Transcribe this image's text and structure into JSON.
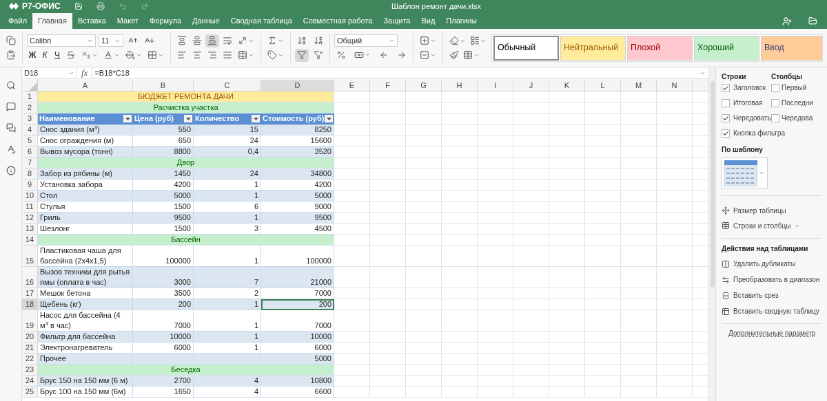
{
  "app": {
    "logo": "Р7-ОФИС",
    "title": "Шаблон ремонт дачи.xlsx"
  },
  "menu_tabs": [
    {
      "label": "Файл",
      "selected": false
    },
    {
      "label": "Главная",
      "selected": true
    },
    {
      "label": "Вставка",
      "selected": false
    },
    {
      "label": "Макет",
      "selected": false
    },
    {
      "label": "Формула",
      "selected": false
    },
    {
      "label": "Данные",
      "selected": false
    },
    {
      "label": "Сводная таблица",
      "selected": false
    },
    {
      "label": "Совместная работа",
      "selected": false
    },
    {
      "label": "Защита",
      "selected": false
    },
    {
      "label": "Вид",
      "selected": false
    },
    {
      "label": "Плагины",
      "selected": false
    }
  ],
  "toolbar": {
    "font": "Calibri",
    "font_size": "11",
    "format_buttons": [
      "Ж",
      "К",
      "Ч"
    ],
    "number_format": "Общий",
    "align_bottom_selected": true,
    "filter_selected": true,
    "styles": [
      {
        "label": {
          "text": "Обычный",
          "color": "#000000"
        },
        "color": "#ffffff",
        "selected": true
      },
      {
        "label": {
          "text": "Нейтральный",
          "color": "#9c5700"
        },
        "color": "#ffeb9c",
        "selected": false
      },
      {
        "label": {
          "text": "Плохой",
          "color": "#9c0006"
        },
        "color": "#ffc7ce",
        "selected": false
      },
      {
        "label": {
          "text": "Хороший",
          "color": "#006100"
        },
        "color": "#c6efce",
        "selected": false
      },
      {
        "label": {
          "text": "Ввод",
          "color": "#3f3f76"
        },
        "color": "#ffcc99",
        "selected": false
      }
    ]
  },
  "formula_bar": {
    "cell": "D18",
    "fx": "fx",
    "formula": "=B18*C18"
  },
  "sheet": {
    "columns": [
      {
        "label": "A",
        "selected": false
      },
      {
        "label": "B",
        "selected": false
      },
      {
        "label": "C",
        "selected": false
      },
      {
        "label": "D",
        "selected": true
      },
      {
        "label": "E",
        "selected": false
      },
      {
        "label": "F",
        "selected": false
      },
      {
        "label": "G",
        "selected": false
      },
      {
        "label": "H",
        "selected": false
      },
      {
        "label": "I",
        "selected": false
      },
      {
        "label": "J",
        "selected": false
      },
      {
        "label": "K",
        "selected": false
      },
      {
        "label": "L",
        "selected": false
      },
      {
        "label": "M",
        "selected": false
      },
      {
        "label": "N",
        "selected": false
      }
    ],
    "rows": [
      {
        "number": "1",
        "kind": "title",
        "text": "БЮДЖЕТ РЕМОНТА ДАЧИ",
        "selected": false
      },
      {
        "number": "2",
        "kind": "section",
        "text": "Расчистка участка",
        "selected": false
      },
      {
        "number": "3",
        "kind": "header",
        "cells": [
          "Наименование",
          "Цена (руб)",
          "Количество",
          "Стоимость (руб)"
        ],
        "selected": false
      },
      {
        "number": "4",
        "kind": "data",
        "banded": true,
        "selected": false,
        "cells": {
          "A": "Снос здания (м$^{3}$)",
          "B": "550",
          "C": "15",
          "D": "8250"
        }
      },
      {
        "number": "5",
        "kind": "data",
        "banded": false,
        "selected": false,
        "cells": {
          "A": "Снос ограждения (м)",
          "B": "650",
          "C": "24",
          "D": "15600"
        }
      },
      {
        "number": "6",
        "kind": "data",
        "banded": true,
        "selected": false,
        "cells": {
          "A": "Вывоз мусора (тонн)",
          "B": "8800",
          "C": "0,4",
          "D": "3520"
        }
      },
      {
        "number": "7",
        "kind": "section",
        "text": "Двор",
        "selected": false
      },
      {
        "number": "8",
        "kind": "data",
        "banded": true,
        "selected": false,
        "cells": {
          "A": "Забор из рябины (м)",
          "B": "1450",
          "C": "24",
          "D": "34800"
        }
      },
      {
        "number": "9",
        "kind": "data",
        "banded": false,
        "selected": false,
        "cells": {
          "A": "Установка забора",
          "B": "4200",
          "C": "1",
          "D": "4200"
        }
      },
      {
        "number": "10",
        "kind": "data",
        "banded": true,
        "selected": false,
        "cells": {
          "A": "Стол",
          "B": "5000",
          "C": "1",
          "D": "5000"
        }
      },
      {
        "number": "11",
        "kind": "data",
        "banded": false,
        "selected": false,
        "cells": {
          "A": "Стулья",
          "B": "1500",
          "C": "6",
          "D": "9000"
        }
      },
      {
        "number": "12",
        "kind": "data",
        "banded": true,
        "selected": false,
        "cells": {
          "A": "Гриль",
          "B": "9500",
          "C": "1",
          "D": "9500"
        }
      },
      {
        "number": "13",
        "kind": "data",
        "banded": false,
        "selected": false,
        "cells": {
          "A": "Шезлонг",
          "B": "1500",
          "C": "3",
          "D": "4500"
        }
      },
      {
        "number": "14",
        "kind": "section",
        "text": "Бассейн",
        "selected": false
      },
      {
        "number": "15",
        "kind": "data",
        "banded": false,
        "selected": false,
        "cells": {
          "A": "Пластиковая чаша для бассейна (2x4x1,5)",
          "B": "100000",
          "C": "1",
          "D": "100000"
        }
      },
      {
        "number": "16",
        "kind": "data",
        "banded": true,
        "selected": false,
        "cells": {
          "A": "Вызов техники для рытья ямы (оплата в час)",
          "B": "3000",
          "C": "7",
          "D": "21000"
        }
      },
      {
        "number": "17",
        "kind": "data",
        "banded": false,
        "selected": false,
        "cells": {
          "A": "Мешок бетона",
          "B": "3500",
          "C": "2",
          "D": "7000"
        }
      },
      {
        "number": "18",
        "kind": "data",
        "banded": true,
        "selected": true,
        "cells": {
          "A": "Щебень (кг)",
          "B": "200",
          "C": "1",
          "D": "200"
        }
      },
      {
        "number": "19",
        "kind": "data",
        "banded": false,
        "selected": false,
        "cells": {
          "A": "Насос для бассейна (4 м$^{3}$ в час)",
          "B": "7000",
          "C": "1",
          "D": "7000"
        }
      },
      {
        "number": "20",
        "kind": "data",
        "banded": true,
        "selected": false,
        "cells": {
          "A": "Фильтр для бассейна",
          "B": "10000",
          "C": "1",
          "D": "10000"
        }
      },
      {
        "number": "21",
        "kind": "data",
        "banded": false,
        "selected": false,
        "cells": {
          "A": "Электронагреватель",
          "B": "6000",
          "C": "1",
          "D": "6000"
        }
      },
      {
        "number": "22",
        "kind": "data",
        "banded": true,
        "selected": false,
        "cells": {
          "A": "Прочее",
          "D": "5000"
        }
      },
      {
        "number": "23",
        "kind": "section",
        "text": "Беседка",
        "selected": false
      },
      {
        "number": "24",
        "kind": "data",
        "banded": true,
        "selected": false,
        "cells": {
          "A": "Брус 150 на 150 мм (6 м)",
          "B": "2700",
          "C": "4",
          "D": "10800"
        }
      },
      {
        "number": "25",
        "kind": "data",
        "banded": false,
        "selected": false,
        "cells": {
          "A": "Брус 100 на 150 мм (6м)",
          "B": "1650",
          "C": "4",
          "D": "6600"
        }
      }
    ]
  },
  "table_panel": {
    "rows_heading": "Строки",
    "columns_heading": "Столбцы",
    "row_options": [
      {
        "label": "Заголовок",
        "checked": true
      },
      {
        "label": "Итоговая",
        "checked": false
      },
      {
        "label": "Чередовать",
        "checked": true
      },
      {
        "label": "Кнопка фильтра",
        "checked": true
      }
    ],
    "column_options": [
      {
        "label": "Первый",
        "checked": false
      },
      {
        "label": "Последни",
        "checked": false
      },
      {
        "label": "Чередова",
        "checked": false
      }
    ],
    "template_heading": "По шаблону",
    "links": [
      {
        "label": "Размер таблицы",
        "has_menu": false
      },
      {
        "label": "Строки и столбцы",
        "has_menu": true
      }
    ],
    "actions_heading": "Действия над таблицами",
    "actions": [
      "Удалить дубликаты",
      "Преобразовать в диапазон",
      "Вставить срез",
      "Вставить сводную таблицу"
    ],
    "advanced": "Дополнительные параметр"
  }
}
